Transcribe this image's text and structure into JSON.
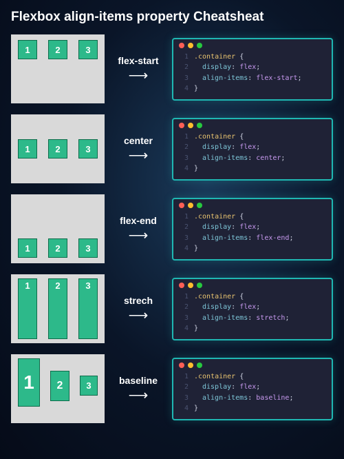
{
  "title": "Flexbox align-items property Cheatsheat",
  "box_labels": [
    "1",
    "2",
    "3"
  ],
  "rows": [
    {
      "label": "flex-start",
      "demo_class": "start",
      "code": {
        "selector": ".container",
        "prop1": "display",
        "val1": "flex",
        "prop2": "align-items",
        "val2": "flex-start"
      }
    },
    {
      "label": "center",
      "demo_class": "center",
      "code": {
        "selector": ".container",
        "prop1": "display",
        "val1": "flex",
        "prop2": "align-items",
        "val2": "center"
      }
    },
    {
      "label": "flex-end",
      "demo_class": "end",
      "code": {
        "selector": ".container",
        "prop1": "display",
        "val1": "flex",
        "prop2": "align-items",
        "val2": "flex-end"
      }
    },
    {
      "label": "strech",
      "demo_class": "stretch",
      "code": {
        "selector": ".container",
        "prop1": "display",
        "val1": "flex",
        "prop2": "align-items",
        "val2": "stretch"
      }
    },
    {
      "label": "baseline",
      "demo_class": "baseline",
      "code": {
        "selector": ".container",
        "prop1": "display",
        "val1": "flex",
        "prop2": "align-items",
        "val2": "baseline"
      }
    }
  ],
  "arrow_glyph": "⟶",
  "line_numbers": [
    "1",
    "2",
    "3",
    "4"
  ]
}
